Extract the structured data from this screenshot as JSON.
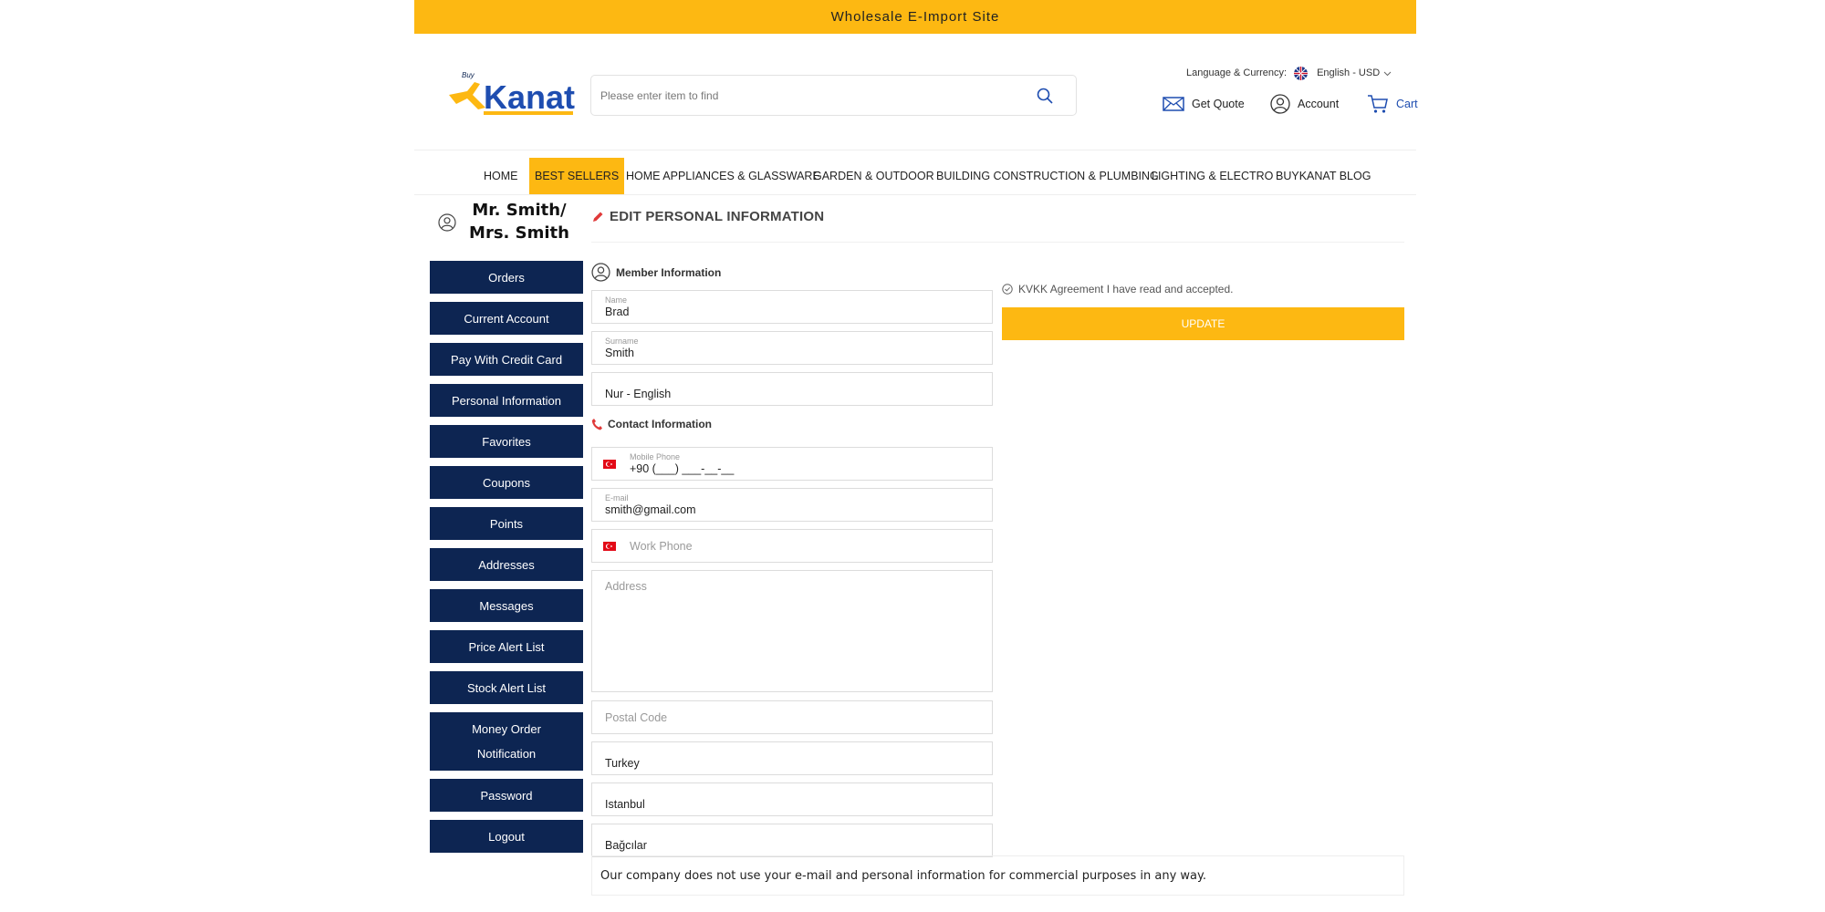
{
  "banner": {
    "text": "Wholesale E-Import Site"
  },
  "header": {
    "logo": {
      "brand": "Kanat",
      "prefix": "Buy"
    },
    "search": {
      "placeholder": "Please enter item to find"
    },
    "language": {
      "label": "Language & Currency:",
      "value": "English - USD"
    },
    "get_quote": "Get Quote",
    "account": "Account",
    "cart": "Cart"
  },
  "nav": {
    "items": [
      "HOME",
      "BEST SELLERS",
      "HOME APPLIANCES & GLASSWARE",
      "GARDEN & OUTDOOR",
      "BUILDING CONSTRUCTION & PLUMBING",
      "LIGHTING & ELECTRO",
      "BUYKANAT BLOG"
    ],
    "active_index": 1
  },
  "profile": {
    "user_name": "Mr. Smith/ Mrs. Smith",
    "page_title": "EDIT PERSONAL INFORMATION"
  },
  "sidebar": {
    "items": [
      "Orders",
      "Current Account",
      "Pay With Credit Card",
      "Personal Information",
      "Favorites",
      "Coupons",
      "Points",
      "Addresses",
      "Messages",
      "Price Alert List",
      "Stock Alert List",
      "Money Order Notification",
      "Password",
      "Logout"
    ]
  },
  "form": {
    "member_title": "Member Information",
    "name": {
      "label": "Name",
      "value": "Brad"
    },
    "surname": {
      "label": "Surname",
      "value": "Smith"
    },
    "language": {
      "value": "Nur - English"
    },
    "contact_title": "Contact Information",
    "mobile": {
      "label": "Mobile Phone",
      "value": "+90 (___) ___-__-__"
    },
    "email": {
      "label": "E-mail",
      "value": "smith@gmail.com"
    },
    "work_phone": {
      "placeholder": "Work Phone"
    },
    "address": {
      "placeholder": "Address"
    },
    "postal_code": {
      "placeholder": "Postal Code"
    },
    "country": {
      "value": "Turkey"
    },
    "city": {
      "value": "Istanbul"
    },
    "district": {
      "value": "Bağcılar"
    },
    "kvkk": "KVKK Agreement I have read and accepted.",
    "update": "UPDATE"
  },
  "notice": "Our company does not use your e-mail and personal information for commercial purposes in any way.",
  "colors": {
    "accent": "#fdb812",
    "sidebar": "#0d2552",
    "link_blue": "#1e4db0"
  }
}
